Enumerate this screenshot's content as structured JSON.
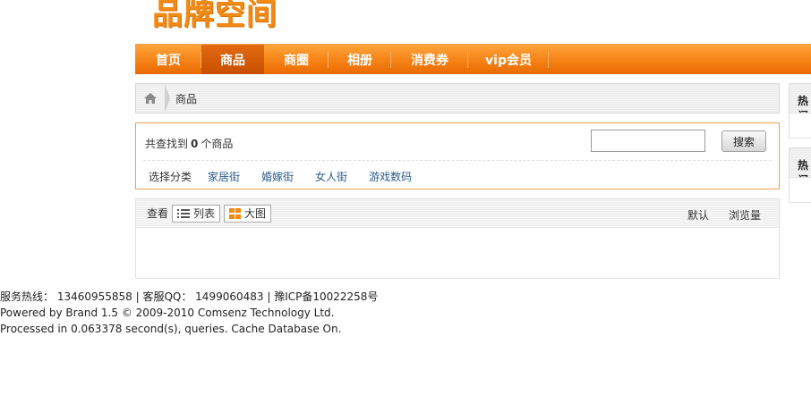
{
  "logo": {
    "text": "品牌空间"
  },
  "nav": {
    "items": [
      {
        "label": "首页"
      },
      {
        "label": "商品"
      },
      {
        "label": "商圈"
      },
      {
        "label": "相册"
      },
      {
        "label": "消费券"
      },
      {
        "label": "vip会员"
      }
    ]
  },
  "breadcrumb": {
    "current": "商品"
  },
  "search": {
    "prefix": "共查找到",
    "count": "0",
    "suffix": "个商品",
    "input_value": "",
    "button_label": "搜索"
  },
  "categories": {
    "label": "选择分类",
    "items": [
      "家居街",
      "婚嫁街",
      "女人街",
      "游戏数码"
    ]
  },
  "list": {
    "view_label": "查看",
    "view_list": "列表",
    "view_grid": "大图",
    "sort": [
      "默认",
      "浏览量"
    ]
  },
  "sidebar": {
    "box1_title": "热门",
    "box2_title": "热门"
  },
  "footer": {
    "line1": "服务热线： 13460955858 | 客服QQ： 1499060483 | 豫ICP备10022258号",
    "line2": "Powered by Brand 1.5 © 2009-2010 Comsenz Technology Ltd.",
    "line3": "Processed in 0.063378 second(s), queries. Cache Database On."
  },
  "colors": {
    "nav_orange": "#f7871b",
    "accent_border": "#f0a04a",
    "link_blue": "#2b5a8c"
  }
}
